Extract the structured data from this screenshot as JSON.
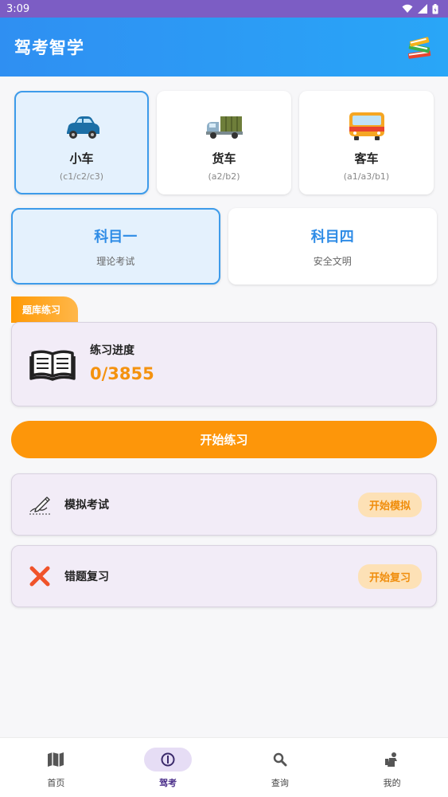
{
  "status_bar": {
    "time": "3:09"
  },
  "app_bar": {
    "title": "驾考智学",
    "icon": "books-icon"
  },
  "vehicles": [
    {
      "name": "小车",
      "sub": "(c1/c2/c3)",
      "icon": "car-icon",
      "selected": true
    },
    {
      "name": "货车",
      "sub": "(a2/b2)",
      "icon": "truck-icon",
      "selected": false
    },
    {
      "name": "客车",
      "sub": "(a1/a3/b1)",
      "icon": "bus-icon",
      "selected": false
    }
  ],
  "subjects": [
    {
      "title": "科目一",
      "sub": "理论考试",
      "selected": true
    },
    {
      "title": "科目四",
      "sub": "安全文明",
      "selected": false
    }
  ],
  "practice": {
    "tag": "题库练习",
    "progress_label": "练习进度",
    "progress_value": "0/3855",
    "start_button": "开始练习"
  },
  "actions": [
    {
      "label": "模拟考试",
      "button": "开始模拟",
      "icon": "pen-writing-icon"
    },
    {
      "label": "错题复习",
      "button": "开始复习",
      "icon": "red-cross-icon"
    }
  ],
  "bottom_nav": [
    {
      "label": "首页",
      "icon": "map-icon",
      "active": false
    },
    {
      "label": "驾考",
      "icon": "exam-icon",
      "active": true
    },
    {
      "label": "查询",
      "icon": "search-icon",
      "active": false
    },
    {
      "label": "我的",
      "icon": "person-icon",
      "active": false
    }
  ],
  "colors": {
    "status_bar": "#7c5dc4",
    "app_bar": "#2f8ff2",
    "accent_orange": "#fd960a",
    "selected_border": "#3d9bea",
    "subject_title": "#2f8ce6"
  }
}
